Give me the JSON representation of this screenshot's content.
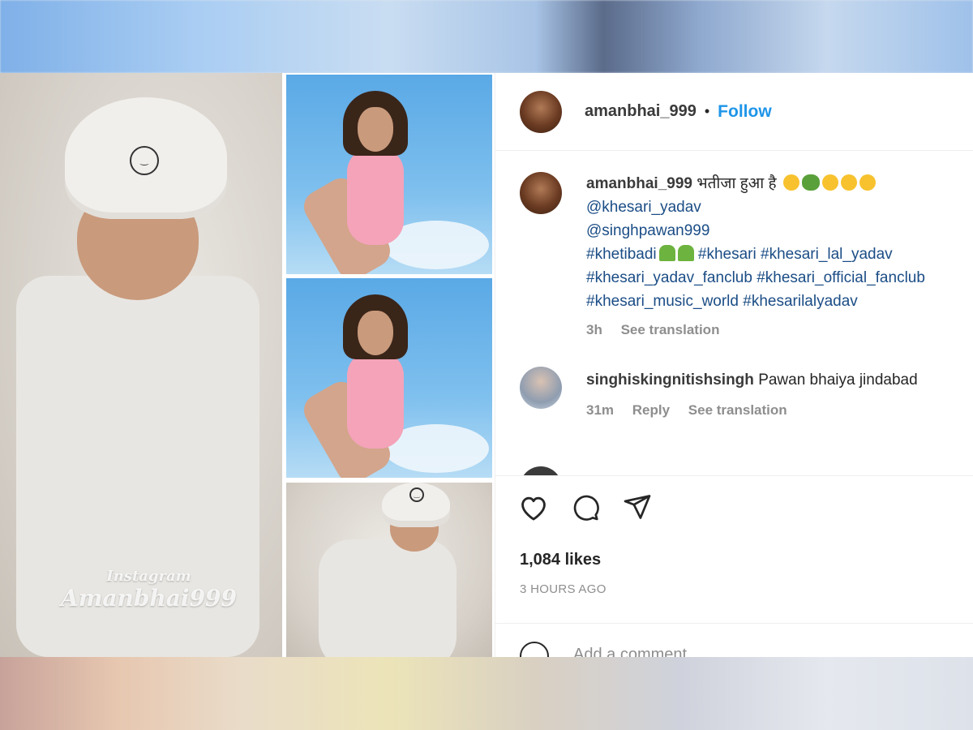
{
  "post": {
    "username": "amanbhai_999",
    "follow_label": "Follow",
    "separator": "•"
  },
  "caption": {
    "username": "amanbhai_999",
    "text": "भतीजा हुआ है",
    "mentions": [
      "@khesari_yadav",
      "@singhpawan999"
    ],
    "hashtag_line1": "#khetibadi",
    "hashtag_line1_rest": "#khesari #khesari_lal_yadav",
    "hashtag_line2": "#khesari_yadav_fanclub #khesari_official_fanclub",
    "hashtag_line3": "#khesari_music_world #khesarilalyadav",
    "time": "3h",
    "see_translation": "See translation"
  },
  "comment": {
    "username": "singhiskingnitishsingh",
    "text": "Pawan bhaiya jindabad",
    "time": "31m",
    "reply": "Reply",
    "see_translation": "See translation"
  },
  "stats": {
    "likes": "1,084 likes",
    "posted": "3 HOURS AGO"
  },
  "add_comment": {
    "placeholder": "Add a comment"
  },
  "watermark": {
    "line1": "Instagram",
    "line2": "Amanbhai999"
  },
  "icons": [
    "heart-icon",
    "comment-icon",
    "share-icon",
    "emoji-icon"
  ]
}
